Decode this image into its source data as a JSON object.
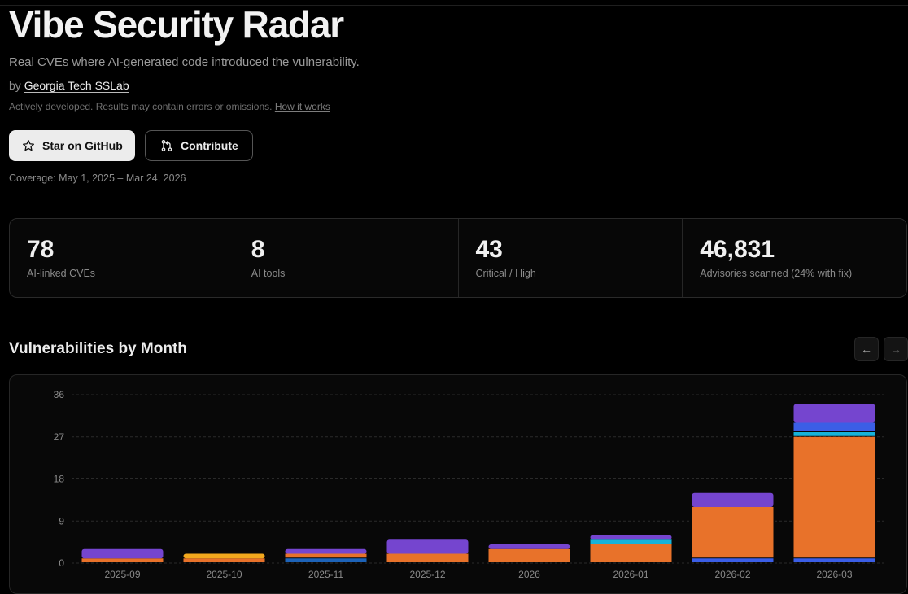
{
  "header": {
    "title": "Vibe Security Radar",
    "subtitle": "Real CVEs where AI-generated code introduced the vulnerability.",
    "by_prefix": "by",
    "org": "Georgia Tech SSLab",
    "disclaimer": "Actively developed. Results may contain errors or omissions.",
    "how_it_works": "How it works"
  },
  "actions": {
    "star_label": "Star on GitHub",
    "contribute_label": "Contribute"
  },
  "coverage": "Coverage: May 1, 2025 – Mar 24, 2026",
  "stats": [
    {
      "value": "78",
      "label": "AI-linked CVEs"
    },
    {
      "value": "8",
      "label": "AI tools"
    },
    {
      "value": "43",
      "label": "Critical / High"
    },
    {
      "value": "46,831",
      "label": "Advisories scanned (24% with fix)"
    }
  ],
  "section": {
    "title": "Vulnerabilities by Month",
    "prev_icon": "arrow-left-icon",
    "next_icon": "arrow-right-icon"
  },
  "colors": {
    "orange": "#e8722a",
    "purple": "#7545cf",
    "blue": "#3b5ee6",
    "cyan": "#17b3d9",
    "amber": "#f2a81d",
    "navy": "#1d63b8"
  },
  "chart_data": {
    "type": "bar",
    "stacked": true,
    "categories": [
      "2025-09",
      "2025-10",
      "2025-11",
      "2025-12",
      "2026",
      "2026-01",
      "2026-02",
      "2026-03"
    ],
    "ylim": [
      0,
      36
    ],
    "yticks": [
      0,
      9,
      18,
      27,
      36
    ],
    "grid": true,
    "series": [
      {
        "color": "#3b5ee6",
        "values": [
          0,
          0,
          0,
          0,
          0,
          0,
          1,
          1
        ]
      },
      {
        "color": "#1d63b8",
        "values": [
          0,
          0,
          1,
          0,
          0,
          0,
          0,
          0
        ]
      },
      {
        "color": "#e8722a",
        "values": [
          1,
          1,
          1,
          2,
          3,
          4,
          11,
          26
        ]
      },
      {
        "color": "#f2a81d",
        "values": [
          0,
          1,
          0,
          0,
          0,
          0,
          0,
          0
        ]
      },
      {
        "color": "#17b3d9",
        "values": [
          0,
          0,
          0,
          0,
          0,
          1,
          0,
          1
        ]
      },
      {
        "color": "#3b5ee6",
        "values": [
          0,
          0,
          0,
          0,
          0,
          0,
          0,
          2
        ]
      },
      {
        "color": "#7545cf",
        "values": [
          2,
          0,
          1,
          3,
          1,
          1,
          3,
          4
        ]
      }
    ]
  }
}
